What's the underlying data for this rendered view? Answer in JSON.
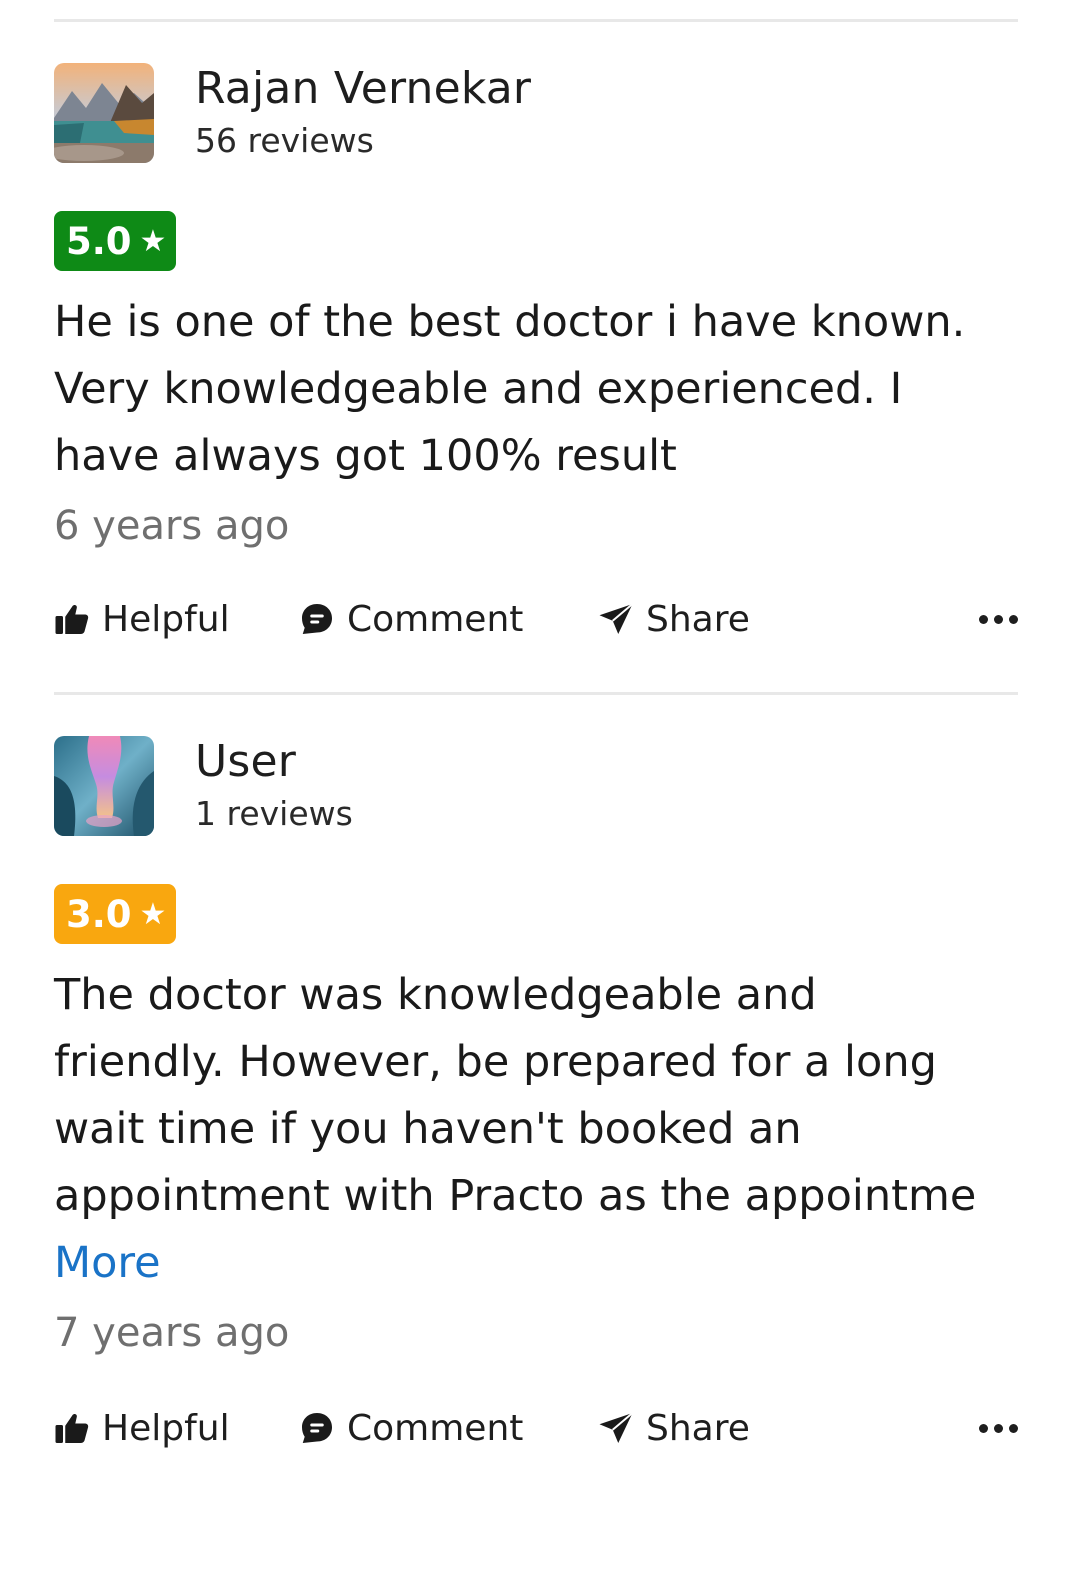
{
  "reviews": [
    {
      "user_name": "Rajan Vernekar",
      "review_count": "56 reviews",
      "rating": "5.0",
      "rating_color": "#0e8a16",
      "star": "★",
      "text": "He is one of the best doctor i have known. Very knowledgeable and experienced. I have always got 100% result",
      "more_label": "",
      "time": "6 years ago",
      "avatar_icon": "landscape-lake-mountains"
    },
    {
      "user_name": "User",
      "review_count": "1 reviews",
      "rating": "3.0",
      "rating_color": "#f9a70f",
      "star": "★",
      "text": "The doctor was knowledgeable and friendly. However, be prepared for a long wait time if you haven't booked an appointment with Practo as the appointme",
      "more_label": "More",
      "time": "7 years ago",
      "avatar_icon": "ice-cave"
    }
  ],
  "actions": {
    "helpful": "Helpful",
    "comment": "Comment",
    "share": "Share",
    "helpful_icon": "thumbs-up-icon",
    "comment_icon": "comment-bubble-icon",
    "share_icon": "paper-plane-icon",
    "more_icon": "more-dots-icon"
  }
}
